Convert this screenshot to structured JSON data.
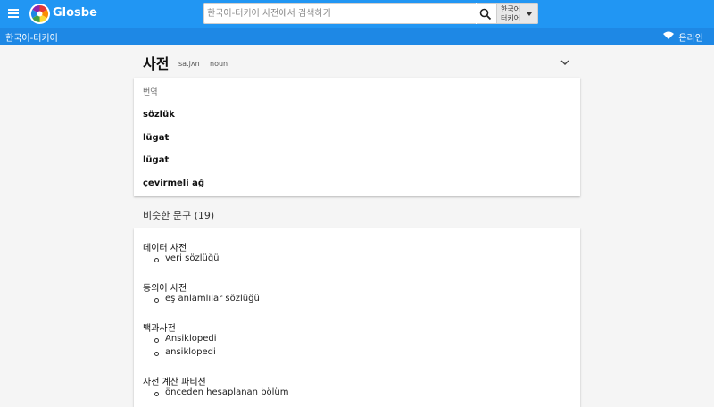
{
  "header": {
    "brand": "Glosbe",
    "search_placeholder": "한국어-터키어 사전에서 검색하기",
    "lang_line1": "한국어",
    "lang_line2": "터키어"
  },
  "subheader": {
    "title": "한국어-터키어",
    "status": "온라인"
  },
  "entry": {
    "headword": "사전",
    "ipa": "sa.jʌn",
    "pos": "noun"
  },
  "translations": {
    "label": "번역",
    "items": [
      "sözlük",
      "lügat",
      "lügat",
      "çevirmeli ağ"
    ]
  },
  "similar": {
    "heading": "비슷한 문구 (19)",
    "groups": [
      {
        "phrase": "데이터 사전",
        "translations": [
          "veri sözlüğü"
        ]
      },
      {
        "phrase": "동의어 사전",
        "translations": [
          "eş anlamlılar sözlüğü"
        ]
      },
      {
        "phrase": "백과사전",
        "translations": [
          "Ansiklopedi",
          "ansiklopedi"
        ]
      },
      {
        "phrase": "사전 계산 파티션",
        "translations": [
          "önceden hesaplanan bölüm"
        ]
      }
    ]
  },
  "colors": {
    "topbar": "#2196f3",
    "subbar": "#1e88e5",
    "background": "#f5f5f5"
  }
}
